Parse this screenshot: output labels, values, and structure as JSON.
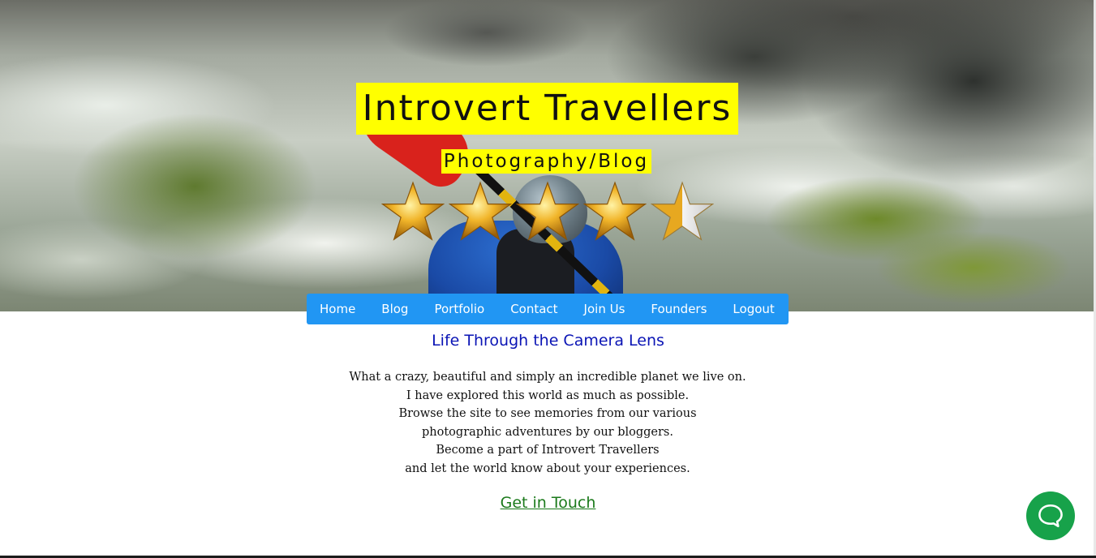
{
  "hero": {
    "title": "Introvert Travellers",
    "subtitle": "Photography/Blog",
    "rating": {
      "stars_total": 5,
      "stars_filled": 4.5
    }
  },
  "nav": {
    "items": [
      {
        "label": "Home"
      },
      {
        "label": "Blog"
      },
      {
        "label": "Portfolio"
      },
      {
        "label": "Contact"
      },
      {
        "label": "Join Us"
      },
      {
        "label": "Founders"
      },
      {
        "label": "Logout"
      }
    ]
  },
  "main": {
    "tagline": "Life Through the Camera Lens",
    "intro_lines": [
      "What a crazy, beautiful and simply an incredible planet we live on.",
      "I have explored this world as much as possible.",
      "Browse the site to see memories from our various",
      "photographic adventures by our bloggers.",
      "Become a part of Introvert Travellers",
      "and let the world know about your experiences."
    ],
    "cta_label": "Get in Touch"
  },
  "chat": {
    "icon": "chat-bubble-icon"
  },
  "colors": {
    "highlight": "#ffff00",
    "nav_bg": "#2196f3",
    "tagline": "#0a14b5",
    "cta": "#1b7a1b",
    "chat_bg": "#17a24a",
    "star_gold": "#e0a318"
  }
}
